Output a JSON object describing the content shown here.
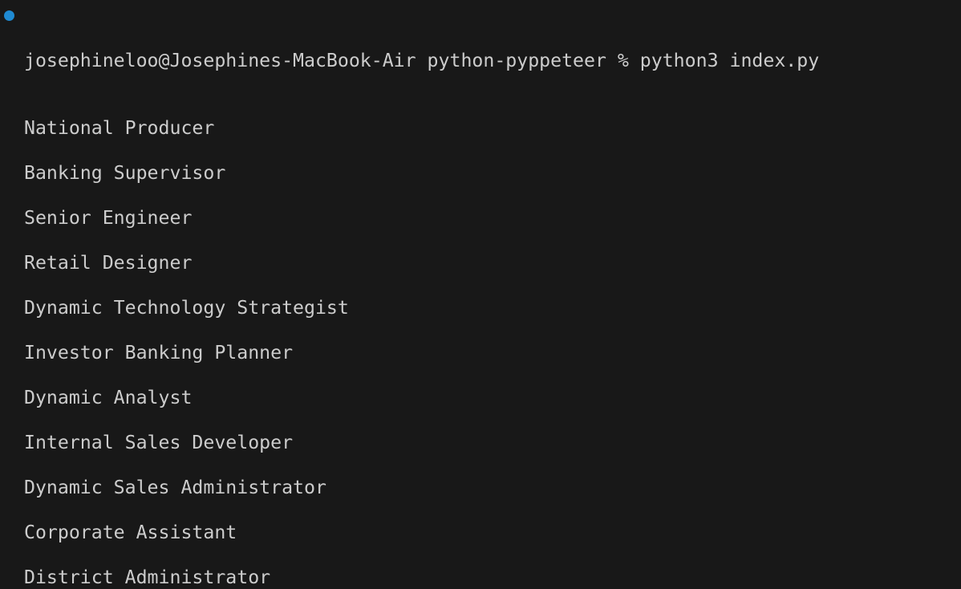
{
  "terminal": {
    "prompt_status_color": "#1f8ad2",
    "command_line": "josephineloo@Josephines-MacBook-Air python-pyppeteer % python3 index.py",
    "output": [
      "National Producer",
      "Banking Supervisor",
      "Senior Engineer",
      "Retail Designer",
      "Dynamic Technology Strategist",
      "Investor Banking Planner",
      "Dynamic Analyst",
      "Internal Sales Developer",
      "Dynamic Sales Administrator",
      "Corporate Assistant",
      "District Administrator"
    ]
  }
}
